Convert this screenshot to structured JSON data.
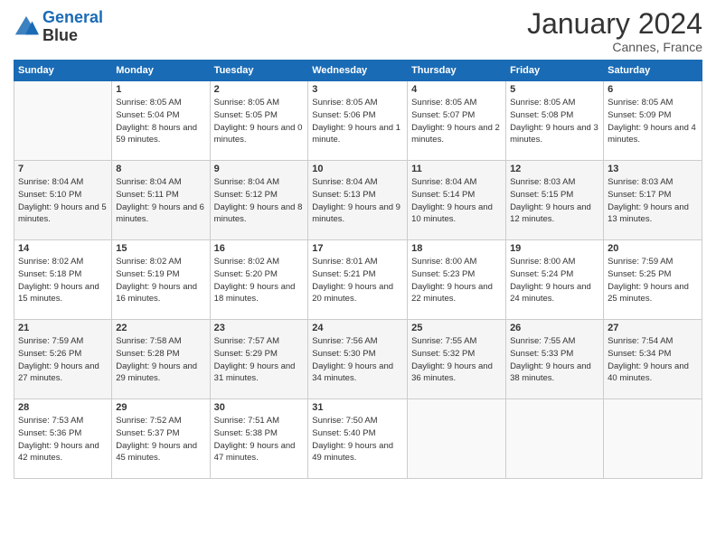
{
  "header": {
    "logo_line1": "General",
    "logo_line2": "Blue",
    "month": "January 2024",
    "location": "Cannes, France"
  },
  "days_of_week": [
    "Sunday",
    "Monday",
    "Tuesday",
    "Wednesday",
    "Thursday",
    "Friday",
    "Saturday"
  ],
  "weeks": [
    [
      {
        "num": "",
        "sunrise": "",
        "sunset": "",
        "daylight": ""
      },
      {
        "num": "1",
        "sunrise": "Sunrise: 8:05 AM",
        "sunset": "Sunset: 5:04 PM",
        "daylight": "Daylight: 8 hours and 59 minutes."
      },
      {
        "num": "2",
        "sunrise": "Sunrise: 8:05 AM",
        "sunset": "Sunset: 5:05 PM",
        "daylight": "Daylight: 9 hours and 0 minutes."
      },
      {
        "num": "3",
        "sunrise": "Sunrise: 8:05 AM",
        "sunset": "Sunset: 5:06 PM",
        "daylight": "Daylight: 9 hours and 1 minute."
      },
      {
        "num": "4",
        "sunrise": "Sunrise: 8:05 AM",
        "sunset": "Sunset: 5:07 PM",
        "daylight": "Daylight: 9 hours and 2 minutes."
      },
      {
        "num": "5",
        "sunrise": "Sunrise: 8:05 AM",
        "sunset": "Sunset: 5:08 PM",
        "daylight": "Daylight: 9 hours and 3 minutes."
      },
      {
        "num": "6",
        "sunrise": "Sunrise: 8:05 AM",
        "sunset": "Sunset: 5:09 PM",
        "daylight": "Daylight: 9 hours and 4 minutes."
      }
    ],
    [
      {
        "num": "7",
        "sunrise": "Sunrise: 8:04 AM",
        "sunset": "Sunset: 5:10 PM",
        "daylight": "Daylight: 9 hours and 5 minutes."
      },
      {
        "num": "8",
        "sunrise": "Sunrise: 8:04 AM",
        "sunset": "Sunset: 5:11 PM",
        "daylight": "Daylight: 9 hours and 6 minutes."
      },
      {
        "num": "9",
        "sunrise": "Sunrise: 8:04 AM",
        "sunset": "Sunset: 5:12 PM",
        "daylight": "Daylight: 9 hours and 8 minutes."
      },
      {
        "num": "10",
        "sunrise": "Sunrise: 8:04 AM",
        "sunset": "Sunset: 5:13 PM",
        "daylight": "Daylight: 9 hours and 9 minutes."
      },
      {
        "num": "11",
        "sunrise": "Sunrise: 8:04 AM",
        "sunset": "Sunset: 5:14 PM",
        "daylight": "Daylight: 9 hours and 10 minutes."
      },
      {
        "num": "12",
        "sunrise": "Sunrise: 8:03 AM",
        "sunset": "Sunset: 5:15 PM",
        "daylight": "Daylight: 9 hours and 12 minutes."
      },
      {
        "num": "13",
        "sunrise": "Sunrise: 8:03 AM",
        "sunset": "Sunset: 5:17 PM",
        "daylight": "Daylight: 9 hours and 13 minutes."
      }
    ],
    [
      {
        "num": "14",
        "sunrise": "Sunrise: 8:02 AM",
        "sunset": "Sunset: 5:18 PM",
        "daylight": "Daylight: 9 hours and 15 minutes."
      },
      {
        "num": "15",
        "sunrise": "Sunrise: 8:02 AM",
        "sunset": "Sunset: 5:19 PM",
        "daylight": "Daylight: 9 hours and 16 minutes."
      },
      {
        "num": "16",
        "sunrise": "Sunrise: 8:02 AM",
        "sunset": "Sunset: 5:20 PM",
        "daylight": "Daylight: 9 hours and 18 minutes."
      },
      {
        "num": "17",
        "sunrise": "Sunrise: 8:01 AM",
        "sunset": "Sunset: 5:21 PM",
        "daylight": "Daylight: 9 hours and 20 minutes."
      },
      {
        "num": "18",
        "sunrise": "Sunrise: 8:00 AM",
        "sunset": "Sunset: 5:23 PM",
        "daylight": "Daylight: 9 hours and 22 minutes."
      },
      {
        "num": "19",
        "sunrise": "Sunrise: 8:00 AM",
        "sunset": "Sunset: 5:24 PM",
        "daylight": "Daylight: 9 hours and 24 minutes."
      },
      {
        "num": "20",
        "sunrise": "Sunrise: 7:59 AM",
        "sunset": "Sunset: 5:25 PM",
        "daylight": "Daylight: 9 hours and 25 minutes."
      }
    ],
    [
      {
        "num": "21",
        "sunrise": "Sunrise: 7:59 AM",
        "sunset": "Sunset: 5:26 PM",
        "daylight": "Daylight: 9 hours and 27 minutes."
      },
      {
        "num": "22",
        "sunrise": "Sunrise: 7:58 AM",
        "sunset": "Sunset: 5:28 PM",
        "daylight": "Daylight: 9 hours and 29 minutes."
      },
      {
        "num": "23",
        "sunrise": "Sunrise: 7:57 AM",
        "sunset": "Sunset: 5:29 PM",
        "daylight": "Daylight: 9 hours and 31 minutes."
      },
      {
        "num": "24",
        "sunrise": "Sunrise: 7:56 AM",
        "sunset": "Sunset: 5:30 PM",
        "daylight": "Daylight: 9 hours and 34 minutes."
      },
      {
        "num": "25",
        "sunrise": "Sunrise: 7:55 AM",
        "sunset": "Sunset: 5:32 PM",
        "daylight": "Daylight: 9 hours and 36 minutes."
      },
      {
        "num": "26",
        "sunrise": "Sunrise: 7:55 AM",
        "sunset": "Sunset: 5:33 PM",
        "daylight": "Daylight: 9 hours and 38 minutes."
      },
      {
        "num": "27",
        "sunrise": "Sunrise: 7:54 AM",
        "sunset": "Sunset: 5:34 PM",
        "daylight": "Daylight: 9 hours and 40 minutes."
      }
    ],
    [
      {
        "num": "28",
        "sunrise": "Sunrise: 7:53 AM",
        "sunset": "Sunset: 5:36 PM",
        "daylight": "Daylight: 9 hours and 42 minutes."
      },
      {
        "num": "29",
        "sunrise": "Sunrise: 7:52 AM",
        "sunset": "Sunset: 5:37 PM",
        "daylight": "Daylight: 9 hours and 45 minutes."
      },
      {
        "num": "30",
        "sunrise": "Sunrise: 7:51 AM",
        "sunset": "Sunset: 5:38 PM",
        "daylight": "Daylight: 9 hours and 47 minutes."
      },
      {
        "num": "31",
        "sunrise": "Sunrise: 7:50 AM",
        "sunset": "Sunset: 5:40 PM",
        "daylight": "Daylight: 9 hours and 49 minutes."
      },
      {
        "num": "",
        "sunrise": "",
        "sunset": "",
        "daylight": ""
      },
      {
        "num": "",
        "sunrise": "",
        "sunset": "",
        "daylight": ""
      },
      {
        "num": "",
        "sunrise": "",
        "sunset": "",
        "daylight": ""
      }
    ]
  ]
}
